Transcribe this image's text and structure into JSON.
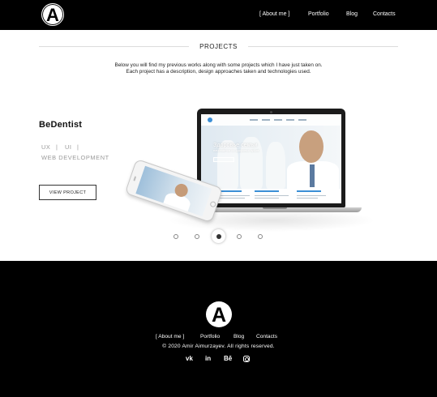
{
  "header": {
    "logo_icon": "a-monogram-logo-icon",
    "nav": {
      "about": "[ About me ]",
      "portfolio": "Portfolio",
      "blog": "Blog",
      "contacts": "Contacts"
    }
  },
  "projects": {
    "title": "PROJECTS",
    "description": "Below you will find my previous works along with some projects which I have just taken on. Each project has a description, design approaches taken and technologies used."
  },
  "project": {
    "name": "BeDentist",
    "tags": {
      "ux": "UX",
      "sep": "|",
      "ui": "UI",
      "web": "WEB DEVELOPMENT"
    },
    "view_button": "VIEW PROJECT",
    "mockup": {
      "hero_title": "Здоровье семьи",
      "hero_subtitle": "начинается со здоровья зубов"
    }
  },
  "carousel": {
    "slide_count": 5,
    "active_index": 2
  },
  "footer": {
    "logo_icon": "a-monogram-logo-icon",
    "nav": {
      "about": "[ About me ]",
      "portfolio": "Portfolio",
      "blog": "Blog",
      "contacts": "Contacts"
    },
    "copyright": "© 2020 Amir Aimurzayev. All rights reserved.",
    "social": {
      "vk_glyph": "vk",
      "linkedin_glyph": "in",
      "behance_glyph": "Bē",
      "icons": [
        "vk-icon",
        "linkedin-icon",
        "behance-icon",
        "instagram-icon"
      ]
    }
  },
  "colors": {
    "header_bg": "#000000",
    "footer_bg": "#000000",
    "accent": "#3b8fd6",
    "tag_gray": "#9a9a9a"
  }
}
